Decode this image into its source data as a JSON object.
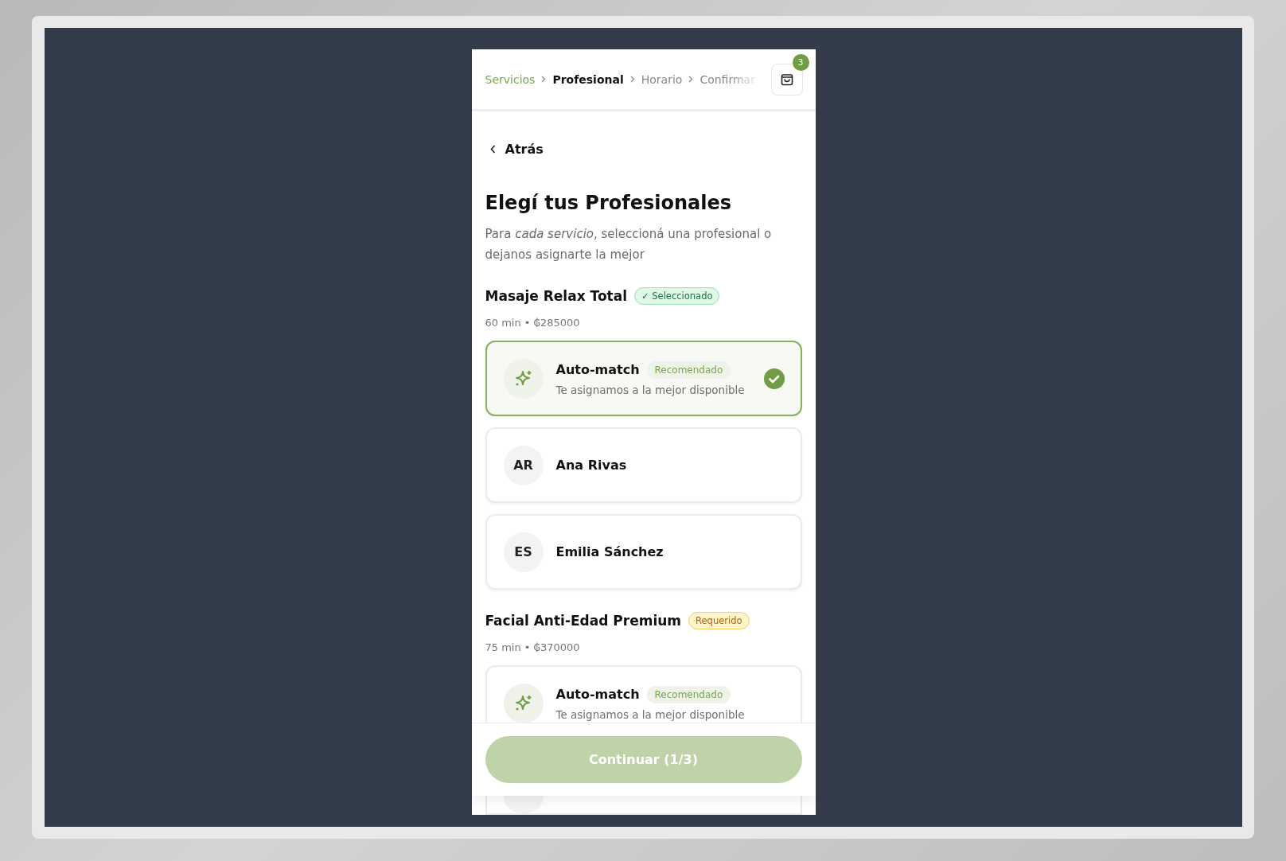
{
  "breadcrumbs": [
    {
      "label": "Servicios",
      "done": true,
      "current": false
    },
    {
      "label": "Profesional",
      "done": false,
      "current": true
    },
    {
      "label": "Horario",
      "done": false,
      "current": false
    },
    {
      "label": "Confirmar",
      "done": false,
      "current": false
    }
  ],
  "cart": {
    "count": "3"
  },
  "back": {
    "label": "Atrás"
  },
  "title": "Elegí tus Profesionales",
  "subtitle": "Para *cada servicio*, seleccioná una profesional o dejanos asignarte la mejor",
  "services": [
    {
      "name": "Masaje Relax Total",
      "status": {
        "kind": "selected",
        "label": "✓ Seleccionado"
      },
      "meta": "60 min • ₲285000",
      "options": [
        {
          "kind": "auto",
          "name": "Auto-match",
          "badge": "Recomendado",
          "description": "Te asignamos a la mejor disponible",
          "selected": true
        },
        {
          "kind": "professional",
          "initials": "AR",
          "name": "Ana Rivas",
          "selected": false
        },
        {
          "kind": "professional",
          "initials": "ES",
          "name": "Emilia Sánchez",
          "selected": false
        }
      ]
    },
    {
      "name": "Facial Anti-Edad Premium",
      "status": {
        "kind": "required",
        "label": "Requerido"
      },
      "meta": "75 min • ₲370000",
      "options": [
        {
          "kind": "auto",
          "name": "Auto-match",
          "badge": "Recomendado",
          "description": "Te asignamos a la mejor disponible",
          "selected": false
        }
      ]
    }
  ],
  "continue": {
    "label": "Continuar (1/3)",
    "disabled": true
  }
}
